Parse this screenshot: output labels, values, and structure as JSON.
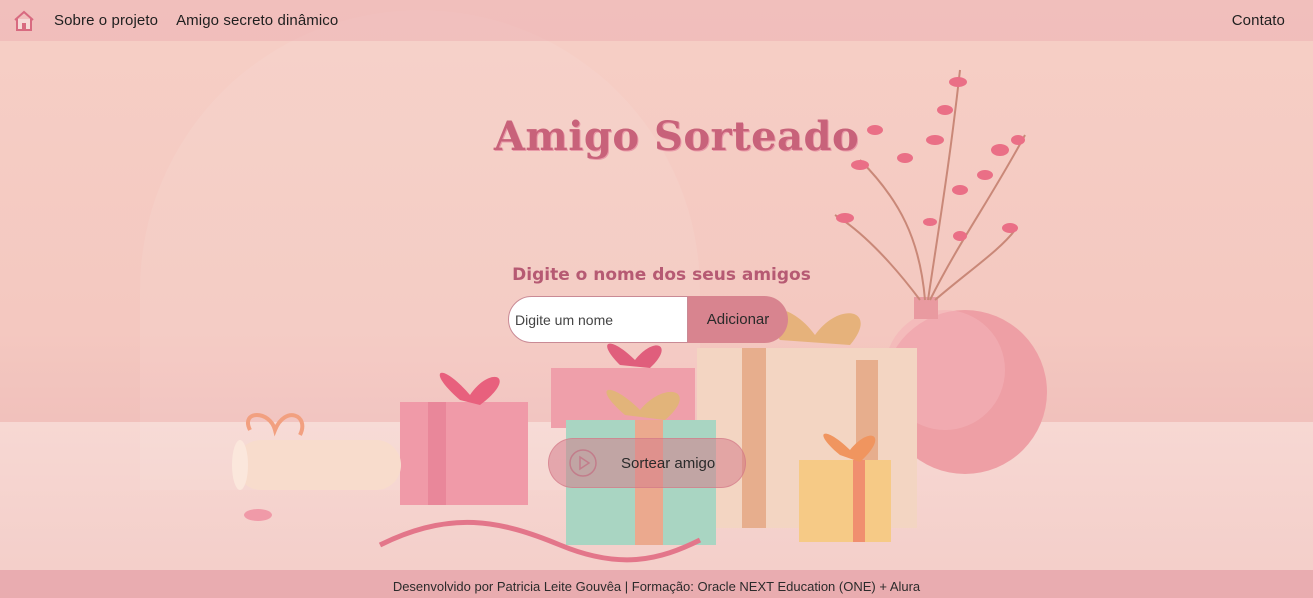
{
  "navbar": {
    "home_icon": "home-icon",
    "links": [
      "Sobre o projeto",
      "Amigo secreto dinâmico"
    ],
    "right_link": "Contato"
  },
  "main": {
    "title": "Amigo Sorteado",
    "subtitle": "Digite o nome dos seus amigos",
    "input_placeholder": "Digite um nome",
    "add_label": "Adicionar",
    "draw_label": "Sortear amigo",
    "draw_icon": "play-icon"
  },
  "footer": {
    "text": "Desenvolvido por Patricia Leite Gouvêa | Formação: Oracle NEXT Education (ONE) + Alura"
  },
  "colors": {
    "accent": "#c8627a",
    "button": "#d8848f",
    "background": "#f4c8c0"
  }
}
